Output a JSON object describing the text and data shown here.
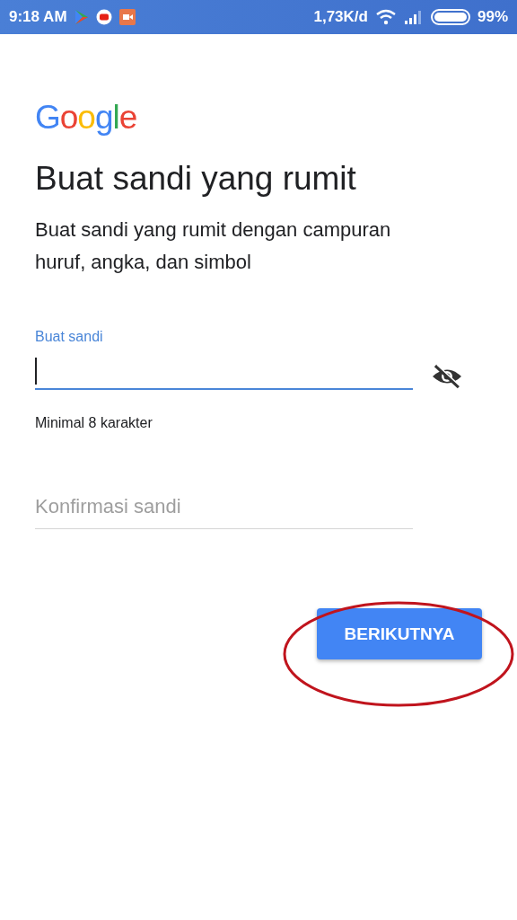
{
  "status_bar": {
    "time": "9:18 AM",
    "speed": "1,73K/d",
    "battery": "99%"
  },
  "logo": "Google",
  "title": "Buat sandi yang rumit",
  "subtitle": "Buat sandi yang rumit dengan campuran huruf, angka, dan simbol",
  "fields": [
    {
      "label": "Buat sandi",
      "focused": true,
      "helper": "Minimal 8 karakter",
      "password_toggle": true
    },
    {
      "placeholder": "Konfirmasi sandi",
      "focused": false
    }
  ],
  "button": "BERIKUTNYA",
  "annotation": {
    "kind": "ellipse"
  }
}
